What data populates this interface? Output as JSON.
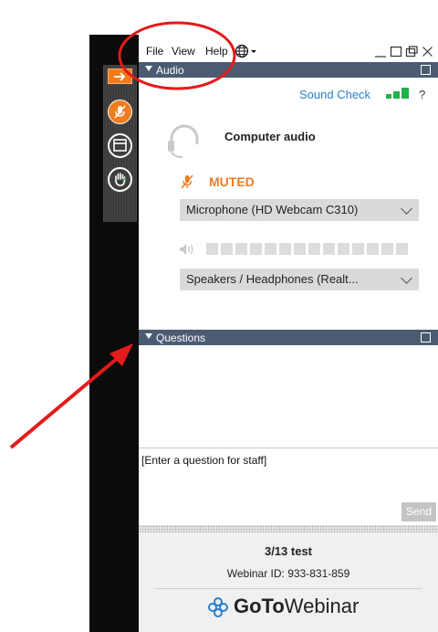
{
  "menu": {
    "file": "File",
    "view": "View",
    "help": "Help"
  },
  "audio": {
    "section_label": "Audio",
    "sound_check": "Sound Check",
    "help": "?",
    "computer_audio": "Computer audio",
    "muted": "MUTED",
    "microphone": "Microphone (HD Webcam C310)",
    "speakers": "Speakers / Headphones (Realt..."
  },
  "questions": {
    "section_label": "Questions",
    "placeholder": "[Enter a question for staff]",
    "send": "Send"
  },
  "footer": {
    "title": "3/13 test",
    "webinar_id": "Webinar ID: 933-831-859",
    "brand_bold": "GoTo",
    "brand_light": "Webinar"
  },
  "colors": {
    "accent": "#f07c1e",
    "header_bar": "#4b5b72",
    "link": "#2a7fcf",
    "annotation": "#e41b1b",
    "green": "#22b04b"
  }
}
